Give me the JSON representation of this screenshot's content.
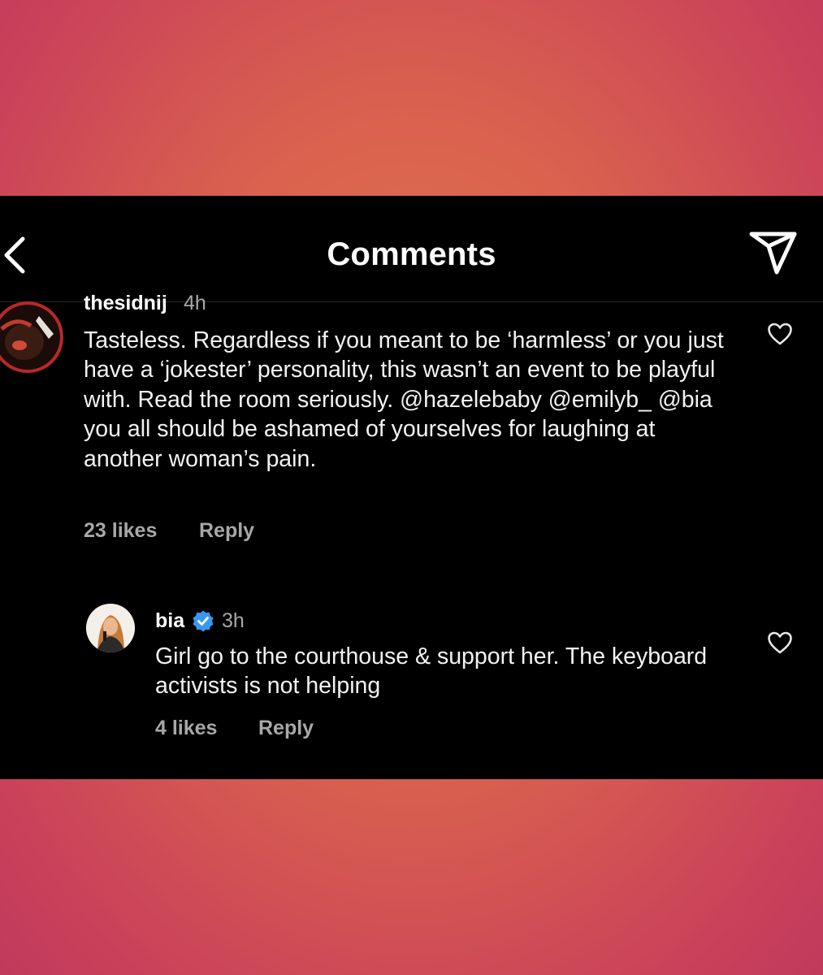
{
  "header": {
    "title": "Comments",
    "back_icon": "chevron-left-icon",
    "send_icon": "send-icon"
  },
  "comments": [
    {
      "username": "thesidnij",
      "time": "4h",
      "text": "Tasteless. Regardless if you meant to be ‘harmless’ or you just have a ‘jokester’ personality, this wasn’t an event to be playful with. Read the room seriously. @hazelebaby @emilyb_ @bia you all should be ashamed of yourselves for laughing at another woman’s pain.",
      "likes": "23 likes",
      "reply_label": "Reply"
    },
    {
      "username": "bia",
      "verified": true,
      "time": "3h",
      "text": "Girl go to the courthouse & support her. The keyboard activists is not helping",
      "likes": "4 likes",
      "reply_label": "Reply"
    }
  ],
  "colors": {
    "background_top": "#e2784a",
    "background_edge": "#c03a5c",
    "panel": "#000000",
    "text_primary": "#ffffff",
    "text_secondary": "#a8a8a8",
    "verified_badge": "#3897f0"
  }
}
